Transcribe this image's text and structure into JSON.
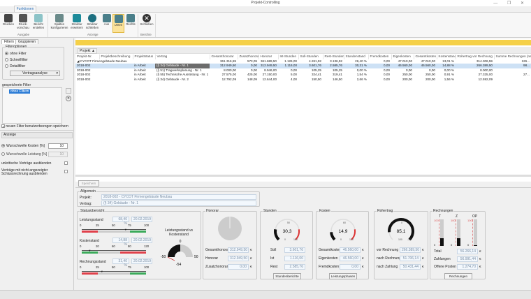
{
  "window": {
    "title": "Projekt-Controlling",
    "controls": "— ❐ ✕"
  },
  "ribbon": {
    "tab": "Funktionen",
    "groups": {
      "ausgabe": "Ausgabe",
      "anzeige": "Anzeige",
      "berichte": "Berichte"
    },
    "buttons": {
      "drucken": "Drucken",
      "vorschau": "Druck-vorschau",
      "bericht": "Bericht erstellen",
      "spalten": "Spalten konfigurieren",
      "erweitern": "Struktur erweitern",
      "schliessen_struktur": "Struktur schließen",
      "aus": "Aus",
      "unten": "Unten",
      "rechts": "Rechts",
      "schliessen": "Schließen"
    },
    "active": "Unten"
  },
  "left": {
    "tabs": [
      "Filtern",
      "Gruppieren"
    ],
    "filteroptionen": {
      "legend": "Filteroptionen",
      "options": [
        "ohne Filter",
        "Schnellfilter",
        "Detailfilter"
      ],
      "selected": "ohne Filter",
      "dropdown": "Vertragsanalyse"
    },
    "saved_label": "gespeicherte Filter",
    "saved_items": [
      "ohne Filtern"
    ],
    "save_new": "neuen Filter benutzerbezogen speichern",
    "anzeige": {
      "title": "Anzeige",
      "kosten_label": "Wunschwelle Kosten [%]",
      "kosten_value": "10",
      "leistung_label": "Wunschwelle Leistung [%]",
      "leistung_value": "10",
      "unkritisch": "unkritische Verträge ausblenden",
      "schlussrechnung": "Verträge mit nicht angezeigter Schlussrechnung ausblenden"
    }
  },
  "table": {
    "groupby": "Projekt ▲",
    "columns": [
      "Projekt-Nr.",
      "Projektbeschreibung",
      "Projektstatus",
      "Vertrag",
      "Gesamthonorar",
      "Zusatzhonorar",
      "Honorar",
      "Ist-Stunden",
      "Soll-Stunden",
      "Rest-Stunden",
      "Stundenstand",
      "Fremdkosten",
      "Eigenkosten",
      "Gesamtkosten",
      "Kostenstand",
      "Rohertrag vor Rechnung",
      "Summe Rechnungen (net)"
    ],
    "group": {
      "label": "◢ CYCOT Firmengebäude Neubau",
      "values": [
        "361.316,59",
        "573,09",
        "361.689,50",
        "1.126,00",
        "4.261,92",
        "3.136,92",
        "26,40 %",
        "0,00",
        "47.010,00",
        "47.010,00",
        "13,01 %",
        "314.306,59",
        "126..."
      ]
    },
    "rows": [
      [
        "2018-002",
        "",
        "in Arbeit",
        "(§ 34) Gebäude - Nr. 1",
        "312.949,50",
        "0,00",
        "312.949,50",
        "1.116,00",
        "3.601,76",
        "2.585,76",
        "30,31 %",
        "0,00",
        "46.560,00",
        "46.560,00",
        "14,88 %",
        "266.389,50",
        "98..."
      ],
      [
        "2018-002",
        "",
        "in Arbeit",
        "(§ 51) Tragwerksplanung - Nr. 1",
        "8.000,00",
        "0,00",
        "8.946,00",
        "0,00",
        "105,25",
        "105,25",
        "0,00 %",
        "0,00",
        "0,00",
        "0,00",
        "0,00 %",
        "8.000,00",
        ""
      ],
      [
        "2018-002",
        "",
        "in Arbeit",
        "(§ 55) Technische Ausrüstung - Nr. 1",
        "27.575,00",
        "425,00",
        "27.150,00",
        "5,00",
        "324,41",
        "319,41",
        "1,54 %",
        "0,00",
        "250,00",
        "250,00",
        "0,91 %",
        "27.325,00",
        "27..."
      ],
      [
        "2018-002",
        "",
        "in Arbeit",
        "(§ 34) Gebäude - Nr. 2",
        "12.792,09",
        "148,09",
        "12.644,00",
        "4,00",
        "150,50",
        "146,50",
        "2,66 %",
        "0,00",
        "200,00",
        "200,00",
        "1,56 %",
        "12.592,09",
        ""
      ]
    ]
  },
  "detail": {
    "save": "Speichern",
    "allgemein": {
      "legend": "Allgemein",
      "projekt_label": "Projekt:",
      "projekt": "2018-002 - CYCOT Firmengebäude Neubau",
      "vertrag_label": "Vertrag:",
      "vertrag": "(§ 34) Gebäude - Nr. 1"
    },
    "status": {
      "legend": "Statusübersicht",
      "bars": [
        {
          "label": "Leistungsstand",
          "pct": "68,40 %",
          "date": "20.02.2019",
          "ticks": [
            "0",
            "25",
            "50",
            "75",
            "100"
          ],
          "value": 68.4,
          "max": 100
        },
        {
          "label": "Kostenstand",
          "pct": "14,88 %",
          "date": "20.02.2019",
          "ticks": [
            "0",
            "20",
            "60",
            "80",
            "120"
          ],
          "value": 14.88,
          "max": 120
        },
        {
          "label": "Rechnungsstand",
          "pct": "31,40 %",
          "date": "20.02.2019",
          "ticks": [
            "0",
            "25",
            "50",
            "75",
            "100"
          ],
          "value": 31.4,
          "max": 100
        }
      ],
      "gauge_title": "Leistungsstand vs Kostenstand",
      "gauge_labels": [
        "-50",
        "0",
        "50"
      ],
      "gauge_value": "-54"
    },
    "honorar": {
      "legend": "Honorar",
      "rows": [
        [
          "Gesamthonorar",
          "312.949,50"
        ],
        [
          "Honorar",
          "312.949,50"
        ],
        [
          "Zusatzhonorar",
          "0,00"
        ]
      ],
      "currency": "€"
    },
    "stunden": {
      "legend": "Stunden",
      "value": "30,3",
      "scale": [
        "0",
        "50",
        "150"
      ],
      "rows": [
        [
          "Soll",
          "3.601,76"
        ],
        [
          "Ist",
          "1.116,00"
        ],
        [
          "Rest",
          "2.585,76"
        ]
      ],
      "button": "Stundenberichte"
    },
    "kosten": {
      "legend": "Kosten",
      "value": "14,9",
      "scale": [
        "0",
        "60",
        "120"
      ],
      "rows": [
        [
          "Gesamtkosten",
          "46.560,00"
        ],
        [
          "Eigenkosten",
          "46.560,00"
        ],
        [
          "Fremdkosten",
          "0,00"
        ]
      ],
      "currency": "€",
      "button": "Leistungsphasen"
    },
    "rohertrag": {
      "legend": "Rohertrag",
      "value": "85,1",
      "scale": [
        "100",
        "0",
        "-30"
      ],
      "rows": [
        [
          "vor Rechnung",
          "266.389,50"
        ],
        [
          "nach Rechnung",
          "51.706,14"
        ],
        [
          "nach Zahlung",
          "50.431,44"
        ]
      ],
      "currency": "€"
    },
    "rechnungen": {
      "legend": "Rechnungen",
      "bars": [
        {
          "label": "T",
          "value": 30
        },
        {
          "label": "Z",
          "value": 30
        },
        {
          "label": "OP",
          "value": 2
        }
      ],
      "scale": [
        "100",
        "0"
      ],
      "rows": [
        [
          "Total",
          "56.266,14"
        ],
        [
          "Zahlungen",
          "56.991,44"
        ],
        [
          "Offene Posten",
          "1.274,70"
        ]
      ],
      "currency": "€",
      "button": "Rechnungen"
    }
  },
  "colors": {
    "accent": "#f5d048",
    "selected": "#cde1f5",
    "red": "#e0404a",
    "green": "#3aaa5a"
  }
}
